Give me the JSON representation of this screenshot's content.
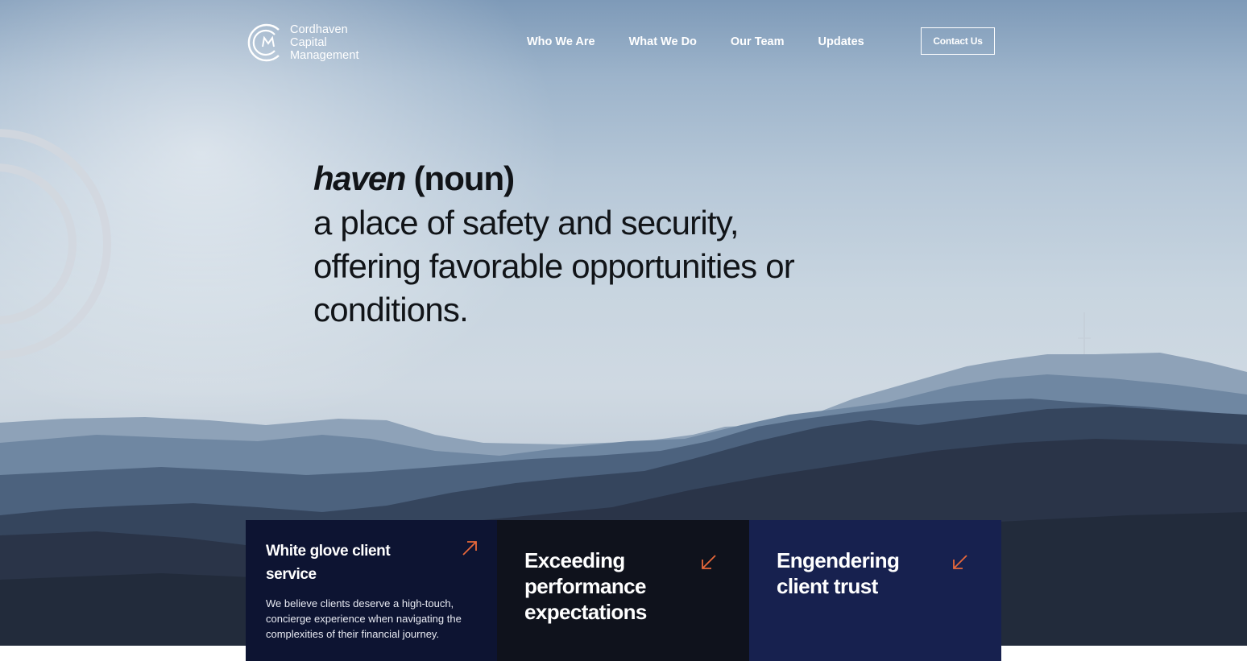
{
  "brand": {
    "name_lines": [
      "Cordhaven",
      "Capital",
      "Management"
    ],
    "logo_letters": "CM"
  },
  "nav": {
    "items": [
      {
        "label": "Who We Are"
      },
      {
        "label": "What We Do"
      },
      {
        "label": "Our Team"
      },
      {
        "label": "Updates"
      }
    ],
    "contact_label": "Contact Us"
  },
  "hero": {
    "word": "haven",
    "part_of_speech": "(noun)",
    "definition_lines": [
      "a place of safety and security,",
      "offering favorable opportunities or",
      "conditions."
    ]
  },
  "cards": [
    {
      "title": "White glove client service",
      "description": "We believe clients deserve a high-touch, concierge experience when navigating the complexities of their financial journey.",
      "arrow": "arrow-up-right-icon"
    },
    {
      "title": "Exceeding performance expectations",
      "arrow": "arrow-down-left-icon"
    },
    {
      "title": "Engendering client trust",
      "arrow": "arrow-down-left-icon"
    }
  ],
  "colors": {
    "accent_arrow": "#e8683a",
    "card_navy": "#0d1432",
    "card_black": "#0f121c",
    "card_blue": "#17214f"
  }
}
